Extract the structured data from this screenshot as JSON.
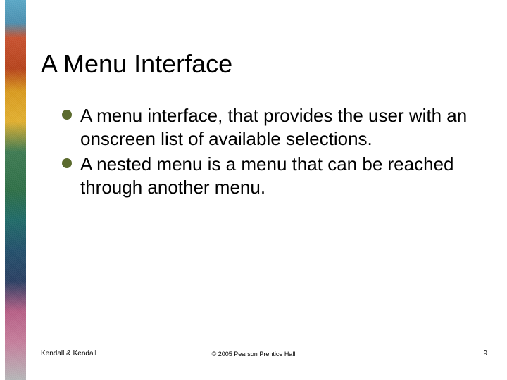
{
  "slide": {
    "title": "A Menu Interface",
    "bullets": [
      "A menu interface, that provides the user with an onscreen list of available selections.",
      "A nested menu is a menu that can be reached through another menu."
    ]
  },
  "footer": {
    "left": "Kendall & Kendall",
    "center": "© 2005 Pearson Prentice Hall",
    "right": "9"
  }
}
